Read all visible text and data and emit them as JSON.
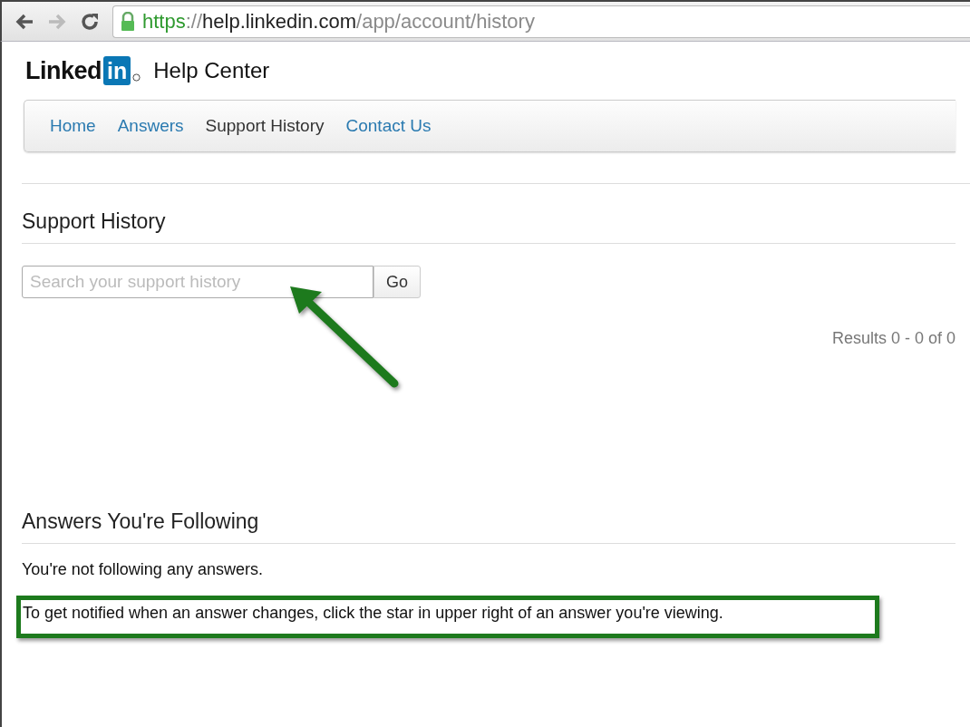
{
  "browser": {
    "url": [
      {
        "text": "https",
        "kind": "scheme"
      },
      {
        "text": "://",
        "kind": "dim"
      },
      {
        "text": "help.linkedin.com",
        "kind": "host"
      },
      {
        "text": "/app/account/history",
        "kind": "dim"
      }
    ]
  },
  "header": {
    "logo_word": "Linked",
    "logo_badge": "in",
    "title": "Help Center"
  },
  "nav": [
    {
      "label": "Home",
      "selected": false
    },
    {
      "label": "Answers",
      "selected": false
    },
    {
      "label": "Support History",
      "selected": true
    },
    {
      "label": "Contact Us",
      "selected": false
    }
  ],
  "support_history": {
    "heading": "Support History",
    "search": {
      "placeholder": "Search your support history"
    },
    "button": "Go",
    "results": "Results 0 - 0 of 0"
  },
  "following": {
    "heading": "Answers You're Following",
    "empty": "You're not following any answers.",
    "tip": "To get notified when an answer changes, click the star in upper right of an answer you're viewing."
  }
}
